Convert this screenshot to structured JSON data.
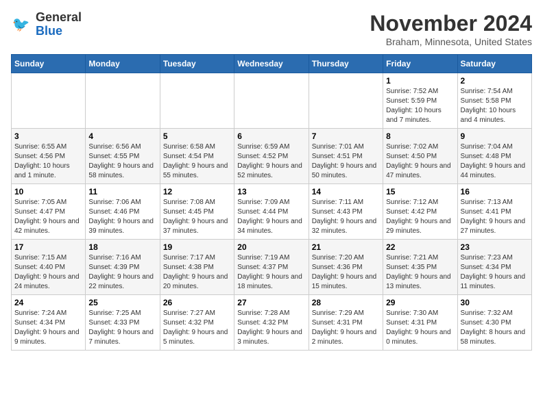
{
  "header": {
    "logo_line1": "General",
    "logo_line2": "Blue",
    "month_title": "November 2024",
    "location": "Braham, Minnesota, United States"
  },
  "days_of_week": [
    "Sunday",
    "Monday",
    "Tuesday",
    "Wednesday",
    "Thursday",
    "Friday",
    "Saturday"
  ],
  "weeks": [
    [
      {
        "day": "",
        "info": ""
      },
      {
        "day": "",
        "info": ""
      },
      {
        "day": "",
        "info": ""
      },
      {
        "day": "",
        "info": ""
      },
      {
        "day": "",
        "info": ""
      },
      {
        "day": "1",
        "info": "Sunrise: 7:52 AM\nSunset: 5:59 PM\nDaylight: 10 hours and 7 minutes."
      },
      {
        "day": "2",
        "info": "Sunrise: 7:54 AM\nSunset: 5:58 PM\nDaylight: 10 hours and 4 minutes."
      }
    ],
    [
      {
        "day": "3",
        "info": "Sunrise: 6:55 AM\nSunset: 4:56 PM\nDaylight: 10 hours and 1 minute."
      },
      {
        "day": "4",
        "info": "Sunrise: 6:56 AM\nSunset: 4:55 PM\nDaylight: 9 hours and 58 minutes."
      },
      {
        "day": "5",
        "info": "Sunrise: 6:58 AM\nSunset: 4:54 PM\nDaylight: 9 hours and 55 minutes."
      },
      {
        "day": "6",
        "info": "Sunrise: 6:59 AM\nSunset: 4:52 PM\nDaylight: 9 hours and 52 minutes."
      },
      {
        "day": "7",
        "info": "Sunrise: 7:01 AM\nSunset: 4:51 PM\nDaylight: 9 hours and 50 minutes."
      },
      {
        "day": "8",
        "info": "Sunrise: 7:02 AM\nSunset: 4:50 PM\nDaylight: 9 hours and 47 minutes."
      },
      {
        "day": "9",
        "info": "Sunrise: 7:04 AM\nSunset: 4:48 PM\nDaylight: 9 hours and 44 minutes."
      }
    ],
    [
      {
        "day": "10",
        "info": "Sunrise: 7:05 AM\nSunset: 4:47 PM\nDaylight: 9 hours and 42 minutes."
      },
      {
        "day": "11",
        "info": "Sunrise: 7:06 AM\nSunset: 4:46 PM\nDaylight: 9 hours and 39 minutes."
      },
      {
        "day": "12",
        "info": "Sunrise: 7:08 AM\nSunset: 4:45 PM\nDaylight: 9 hours and 37 minutes."
      },
      {
        "day": "13",
        "info": "Sunrise: 7:09 AM\nSunset: 4:44 PM\nDaylight: 9 hours and 34 minutes."
      },
      {
        "day": "14",
        "info": "Sunrise: 7:11 AM\nSunset: 4:43 PM\nDaylight: 9 hours and 32 minutes."
      },
      {
        "day": "15",
        "info": "Sunrise: 7:12 AM\nSunset: 4:42 PM\nDaylight: 9 hours and 29 minutes."
      },
      {
        "day": "16",
        "info": "Sunrise: 7:13 AM\nSunset: 4:41 PM\nDaylight: 9 hours and 27 minutes."
      }
    ],
    [
      {
        "day": "17",
        "info": "Sunrise: 7:15 AM\nSunset: 4:40 PM\nDaylight: 9 hours and 24 minutes."
      },
      {
        "day": "18",
        "info": "Sunrise: 7:16 AM\nSunset: 4:39 PM\nDaylight: 9 hours and 22 minutes."
      },
      {
        "day": "19",
        "info": "Sunrise: 7:17 AM\nSunset: 4:38 PM\nDaylight: 9 hours and 20 minutes."
      },
      {
        "day": "20",
        "info": "Sunrise: 7:19 AM\nSunset: 4:37 PM\nDaylight: 9 hours and 18 minutes."
      },
      {
        "day": "21",
        "info": "Sunrise: 7:20 AM\nSunset: 4:36 PM\nDaylight: 9 hours and 15 minutes."
      },
      {
        "day": "22",
        "info": "Sunrise: 7:21 AM\nSunset: 4:35 PM\nDaylight: 9 hours and 13 minutes."
      },
      {
        "day": "23",
        "info": "Sunrise: 7:23 AM\nSunset: 4:34 PM\nDaylight: 9 hours and 11 minutes."
      }
    ],
    [
      {
        "day": "24",
        "info": "Sunrise: 7:24 AM\nSunset: 4:34 PM\nDaylight: 9 hours and 9 minutes."
      },
      {
        "day": "25",
        "info": "Sunrise: 7:25 AM\nSunset: 4:33 PM\nDaylight: 9 hours and 7 minutes."
      },
      {
        "day": "26",
        "info": "Sunrise: 7:27 AM\nSunset: 4:32 PM\nDaylight: 9 hours and 5 minutes."
      },
      {
        "day": "27",
        "info": "Sunrise: 7:28 AM\nSunset: 4:32 PM\nDaylight: 9 hours and 3 minutes."
      },
      {
        "day": "28",
        "info": "Sunrise: 7:29 AM\nSunset: 4:31 PM\nDaylight: 9 hours and 2 minutes."
      },
      {
        "day": "29",
        "info": "Sunrise: 7:30 AM\nSunset: 4:31 PM\nDaylight: 9 hours and 0 minutes."
      },
      {
        "day": "30",
        "info": "Sunrise: 7:32 AM\nSunset: 4:30 PM\nDaylight: 8 hours and 58 minutes."
      }
    ]
  ]
}
